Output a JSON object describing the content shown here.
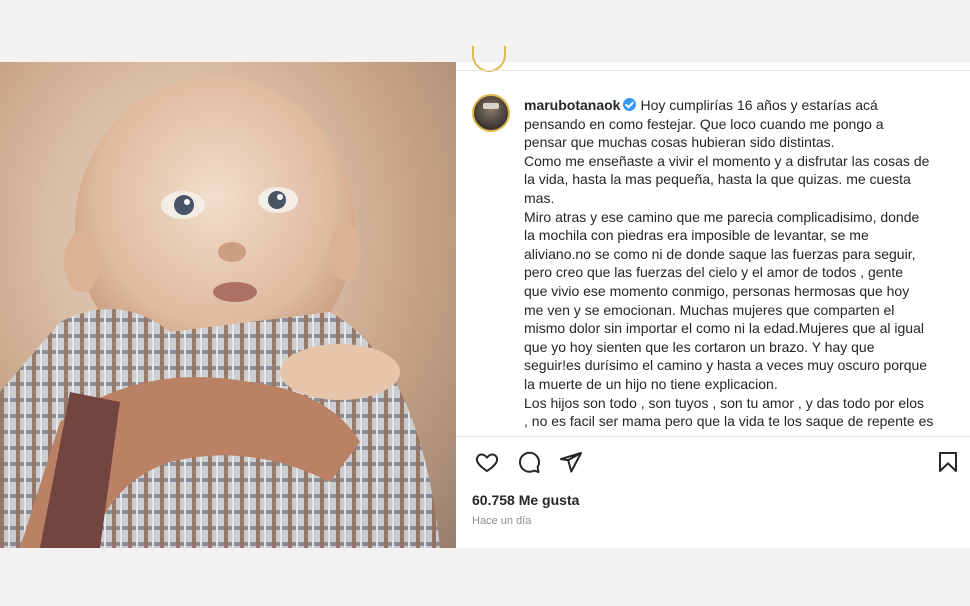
{
  "post": {
    "username": "marubotanaok",
    "caption_lines": [
      "Hoy cumplirías 16 años y estarías acá",
      "pensando en como festejar. Que loco cuando me pongo a",
      "pensar que muchas cosas hubieran sido distintas.",
      "Como me enseñaste a vivir el momento y a disfrutar las cosas de",
      "la vida, hasta la mas pequeña, hasta la que quizas. me cuesta",
      "mas.",
      "Miro atras y ese camino que me parecia complicadisimo, donde",
      "la mochila con piedras era imposible de levantar, se me",
      "aliviano.no se como ni de donde saque las fuerzas para seguir,",
      "pero creo que las fuerzas del cielo y el amor de todos , gente",
      "que vivio ese momento conmigo, personas hermosas que hoy",
      "me ven y se emocionan. Muchas mujeres que comparten el",
      "mismo dolor sin importar el como ni la edad.Mujeres que al igual",
      "que yo hoy sienten que les cortaron un brazo. Y hay que",
      "seguir!es durísimo el camino y hasta a veces muy oscuro porque",
      "la muerte de un hijo no tiene explicacion.",
      "Los hijos son todo , son tuyos , son tu amor , y das todo por elos",
      ", no es facil ser mama pero que la vida te los saque de repente es"
    ],
    "likes": "60.758 Me gusta",
    "time_ago": "Hace un día"
  },
  "icons": {
    "like": "heart-icon",
    "comment": "comment-icon",
    "share": "share-icon",
    "save": "bookmark-icon",
    "verified": "verified-badge-icon"
  },
  "colors": {
    "verified": "#3897f0",
    "story_ring": "#e0b94f",
    "text": "#262626",
    "muted": "#8e8e8e"
  }
}
